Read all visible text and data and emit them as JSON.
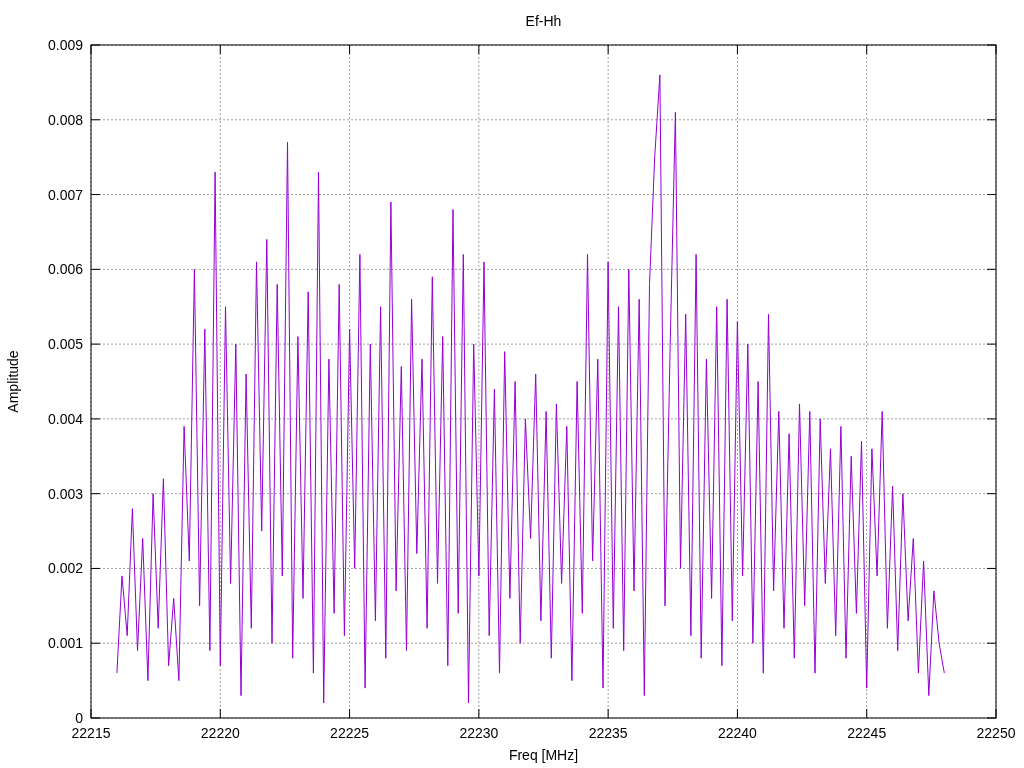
{
  "chart_data": {
    "type": "line",
    "title": "Ef-Hh",
    "xlabel": "Freq [MHz]",
    "ylabel": "Amplitude",
    "xlim": [
      22215,
      22250
    ],
    "ylim": [
      0,
      0.009
    ],
    "grid": true,
    "xticks": [
      {
        "value": 22215,
        "label": "22215"
      },
      {
        "value": 22220,
        "label": "22220"
      },
      {
        "value": 22225,
        "label": "22225"
      },
      {
        "value": 22230,
        "label": "22230"
      },
      {
        "value": 22235,
        "label": "22235"
      },
      {
        "value": 22240,
        "label": "22240"
      },
      {
        "value": 22245,
        "label": "22245"
      },
      {
        "value": 22250,
        "label": "22250"
      }
    ],
    "yticks": [
      {
        "value": 0,
        "label": "0"
      },
      {
        "value": 0.001,
        "label": "0.001"
      },
      {
        "value": 0.002,
        "label": "0.002"
      },
      {
        "value": 0.003,
        "label": "0.003"
      },
      {
        "value": 0.004,
        "label": "0.004"
      },
      {
        "value": 0.005,
        "label": "0.005"
      },
      {
        "value": 0.006,
        "label": "0.006"
      },
      {
        "value": 0.007,
        "label": "0.007"
      },
      {
        "value": 0.008,
        "label": "0.008"
      },
      {
        "value": 0.009,
        "label": "0.009"
      }
    ],
    "x": [
      22216,
      22216.2,
      22216.4,
      22216.6,
      22216.8,
      22217,
      22217.2,
      22217.4,
      22217.6,
      22217.8,
      22218,
      22218.2,
      22218.4,
      22218.6,
      22218.8,
      22219,
      22219.2,
      22219.4,
      22219.6,
      22219.8,
      22220,
      22220.2,
      22220.4,
      22220.6,
      22220.8,
      22221,
      22221.2,
      22221.4,
      22221.6,
      22221.8,
      22222,
      22222.2,
      22222.4,
      22222.6,
      22222.8,
      22223,
      22223.2,
      22223.4,
      22223.6,
      22223.8,
      22224,
      22224.2,
      22224.4,
      22224.6,
      22224.8,
      22225,
      22225.2,
      22225.4,
      22225.6,
      22225.8,
      22226,
      22226.2,
      22226.4,
      22226.6,
      22226.8,
      22227,
      22227.2,
      22227.4,
      22227.6,
      22227.8,
      22228,
      22228.2,
      22228.4,
      22228.6,
      22228.8,
      22229,
      22229.2,
      22229.4,
      22229.6,
      22229.8,
      22230,
      22230.2,
      22230.4,
      22230.6,
      22230.8,
      22231,
      22231.2,
      22231.4,
      22231.6,
      22231.8,
      22232,
      22232.2,
      22232.4,
      22232.6,
      22232.8,
      22233,
      22233.2,
      22233.4,
      22233.6,
      22233.8,
      22234,
      22234.2,
      22234.4,
      22234.6,
      22234.8,
      22235,
      22235.2,
      22235.4,
      22235.6,
      22235.8,
      22236,
      22236.2,
      22236.4,
      22236.6,
      22236.8,
      22237,
      22237.2,
      22237.4,
      22237.6,
      22237.8,
      22238,
      22238.2,
      22238.4,
      22238.6,
      22238.8,
      22239,
      22239.2,
      22239.4,
      22239.6,
      22239.8,
      22240,
      22240.2,
      22240.4,
      22240.6,
      22240.8,
      22241,
      22241.2,
      22241.4,
      22241.6,
      22241.8,
      22242,
      22242.2,
      22242.4,
      22242.6,
      22242.8,
      22243,
      22243.2,
      22243.4,
      22243.6,
      22243.8,
      22244,
      22244.2,
      22244.4,
      22244.6,
      22244.8,
      22245,
      22245.2,
      22245.4,
      22245.6,
      22245.8,
      22246,
      22246.2,
      22246.4,
      22246.6,
      22246.8,
      22247,
      22247.2,
      22247.4,
      22247.6,
      22247.8,
      22248
    ],
    "series": [
      {
        "color": "#9400d3",
        "values": [
          0.0006,
          0.0019,
          0.0011,
          0.0028,
          0.0009,
          0.0024,
          0.0005,
          0.003,
          0.0012,
          0.0032,
          0.0007,
          0.0016,
          0.0005,
          0.0039,
          0.0021,
          0.006,
          0.0015,
          0.0052,
          0.0009,
          0.0073,
          0.0007,
          0.0055,
          0.0018,
          0.005,
          0.0003,
          0.0046,
          0.0012,
          0.0061,
          0.0025,
          0.0064,
          0.001,
          0.0058,
          0.0019,
          0.0077,
          0.0008,
          0.0051,
          0.0016,
          0.0057,
          0.0006,
          0.0073,
          0.0002,
          0.0048,
          0.0014,
          0.0058,
          0.0011,
          0.0052,
          0.002,
          0.0062,
          0.0004,
          0.005,
          0.0013,
          0.0055,
          0.0008,
          0.0069,
          0.0017,
          0.0047,
          0.0009,
          0.0056,
          0.0022,
          0.0048,
          0.0012,
          0.0059,
          0.0018,
          0.0051,
          0.0007,
          0.0068,
          0.0014,
          0.0062,
          0.0002,
          0.005,
          0.0019,
          0.0061,
          0.0011,
          0.0044,
          0.0006,
          0.0049,
          0.0016,
          0.0045,
          0.001,
          0.004,
          0.0024,
          0.0046,
          0.0013,
          0.0041,
          0.0008,
          0.0042,
          0.0018,
          0.0039,
          0.0005,
          0.0045,
          0.0014,
          0.0062,
          0.0021,
          0.0048,
          0.0004,
          0.0061,
          0.0012,
          0.0055,
          0.0009,
          0.006,
          0.0017,
          0.0056,
          0.0003,
          0.0058,
          0.0075,
          0.0086,
          0.0015,
          0.005,
          0.0081,
          0.002,
          0.0054,
          0.0011,
          0.0062,
          0.0008,
          0.0048,
          0.0016,
          0.0055,
          0.0007,
          0.0056,
          0.0013,
          0.0053,
          0.0019,
          0.005,
          0.001,
          0.0045,
          0.0006,
          0.0054,
          0.0017,
          0.0041,
          0.0012,
          0.0038,
          0.0008,
          0.0042,
          0.0015,
          0.0041,
          0.0006,
          0.004,
          0.0018,
          0.0036,
          0.0011,
          0.0039,
          0.0008,
          0.0035,
          0.0014,
          0.0037,
          0.0004,
          0.0036,
          0.0019,
          0.0041,
          0.0012,
          0.0031,
          0.0009,
          0.003,
          0.0013,
          0.0024,
          0.0006,
          0.0021,
          0.0003,
          0.0017,
          0.001,
          0.0006
        ]
      }
    ]
  }
}
